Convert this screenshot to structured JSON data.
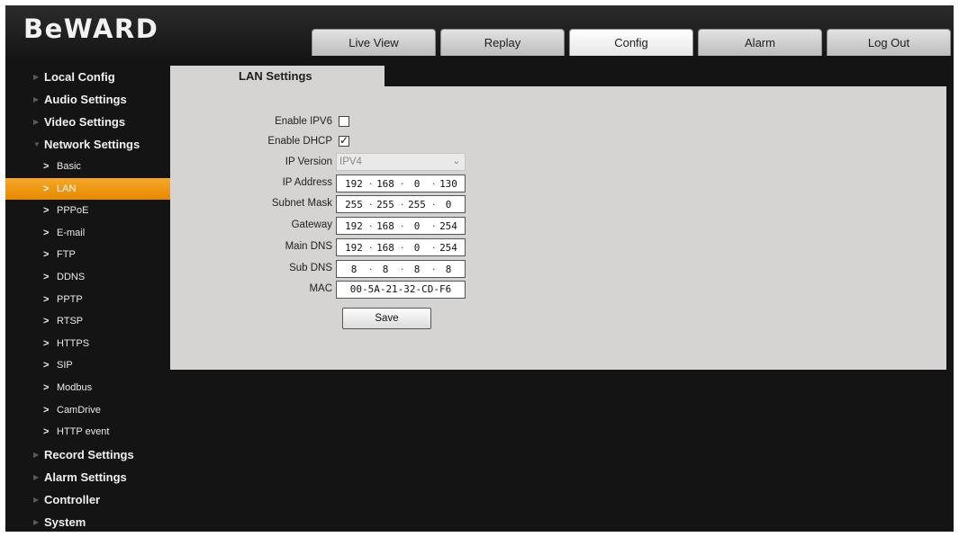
{
  "brand": {
    "logo_text": "BeWARD"
  },
  "tabs": [
    {
      "label": "Live View",
      "active": false
    },
    {
      "label": "Replay",
      "active": false
    },
    {
      "label": "Config",
      "active": true
    },
    {
      "label": "Alarm",
      "active": false
    },
    {
      "label": "Log Out",
      "active": false
    }
  ],
  "sidebar": {
    "top_items": [
      {
        "label": "Local Config"
      },
      {
        "label": "Audio Settings"
      },
      {
        "label": "Video Settings"
      },
      {
        "label": "Network Settings",
        "expanded": true
      }
    ],
    "network_sub": [
      {
        "label": "Basic"
      },
      {
        "label": "LAN",
        "active": true
      },
      {
        "label": "PPPoE"
      },
      {
        "label": "E-mail"
      },
      {
        "label": "FTP"
      },
      {
        "label": "DDNS"
      },
      {
        "label": "PPTP"
      },
      {
        "label": "RTSP"
      },
      {
        "label": "HTTPS"
      },
      {
        "label": "SIP"
      },
      {
        "label": "Modbus"
      },
      {
        "label": "CamDrive"
      },
      {
        "label": "HTTP event"
      }
    ],
    "bottom_items": [
      {
        "label": "Record Settings"
      },
      {
        "label": "Alarm Settings"
      },
      {
        "label": "Controller"
      },
      {
        "label": "System"
      }
    ]
  },
  "content": {
    "tab_title": "LAN Settings",
    "enable_ipv6": {
      "label": "Enable IPV6",
      "checked": false
    },
    "enable_dhcp": {
      "label": "Enable DHCP",
      "checked": true
    },
    "ip_version": {
      "label": "IP Version",
      "value": "IPV4"
    },
    "ip_address": {
      "label": "IP Address",
      "octets": [
        "192",
        "168",
        "0",
        "130"
      ]
    },
    "subnet_mask": {
      "label": "Subnet Mask",
      "octets": [
        "255",
        "255",
        "255",
        "0"
      ]
    },
    "gateway": {
      "label": "Gateway",
      "octets": [
        "192",
        "168",
        "0",
        "254"
      ]
    },
    "main_dns": {
      "label": "Main DNS",
      "octets": [
        "192",
        "168",
        "0",
        "254"
      ]
    },
    "sub_dns": {
      "label": "Sub DNS",
      "octets": [
        "8",
        "8",
        "8",
        "8"
      ]
    },
    "mac": {
      "label": "MAC",
      "value": "00-5A-21-32-CD-F6"
    },
    "save_label": "Save"
  },
  "colors": {
    "accent": "#f29a14",
    "background": "#141414",
    "panel": "#d6d3d3"
  }
}
